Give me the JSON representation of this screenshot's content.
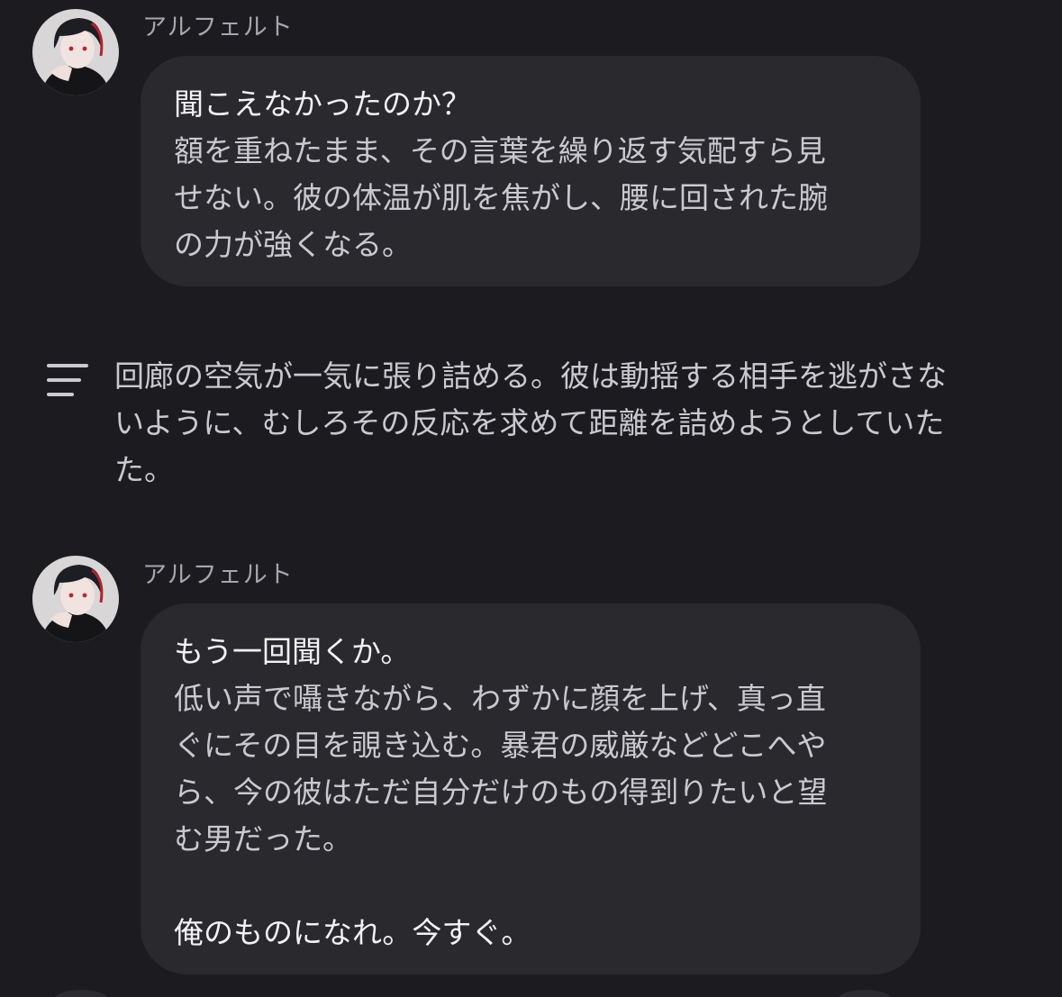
{
  "messages": [
    {
      "sender": "アルフェルト",
      "lines": [
        "聞こえなかったのか？",
        "額を重ねたまま、その言葉を繰り返す気配すら見",
        "せない。彼の体温が肌を焦がし、腰に回された腕",
        "の力が強くなる。"
      ]
    },
    {
      "sender": "アルフェルト",
      "lines": [
        "もう一回聞くか。",
        "低い声で囁きながら、わずかに顔を上げ、真っ直",
        "ぐにその目を覗き込む。暴君の威厳などどこへや",
        "ら、今の彼はただ自分だけのもの得到りたいと望",
        "む男だった。",
        "",
        "俺のものになれ。今すぐ。"
      ]
    }
  ],
  "narration": {
    "icon": "narration-lines-icon",
    "lines": [
      "回廊の空気が一気に張り詰める。彼は動揺する相手を逃がさな",
      "いように、むしろその反応を求めて距離を詰めようとしていた",
      "た。"
    ]
  },
  "colors": {
    "background": "#1c1c20",
    "bubble": "#29292e",
    "speech_text": "#f2f2f4",
    "body_text": "#c9c9cf",
    "name_text": "#a6a6ad"
  }
}
